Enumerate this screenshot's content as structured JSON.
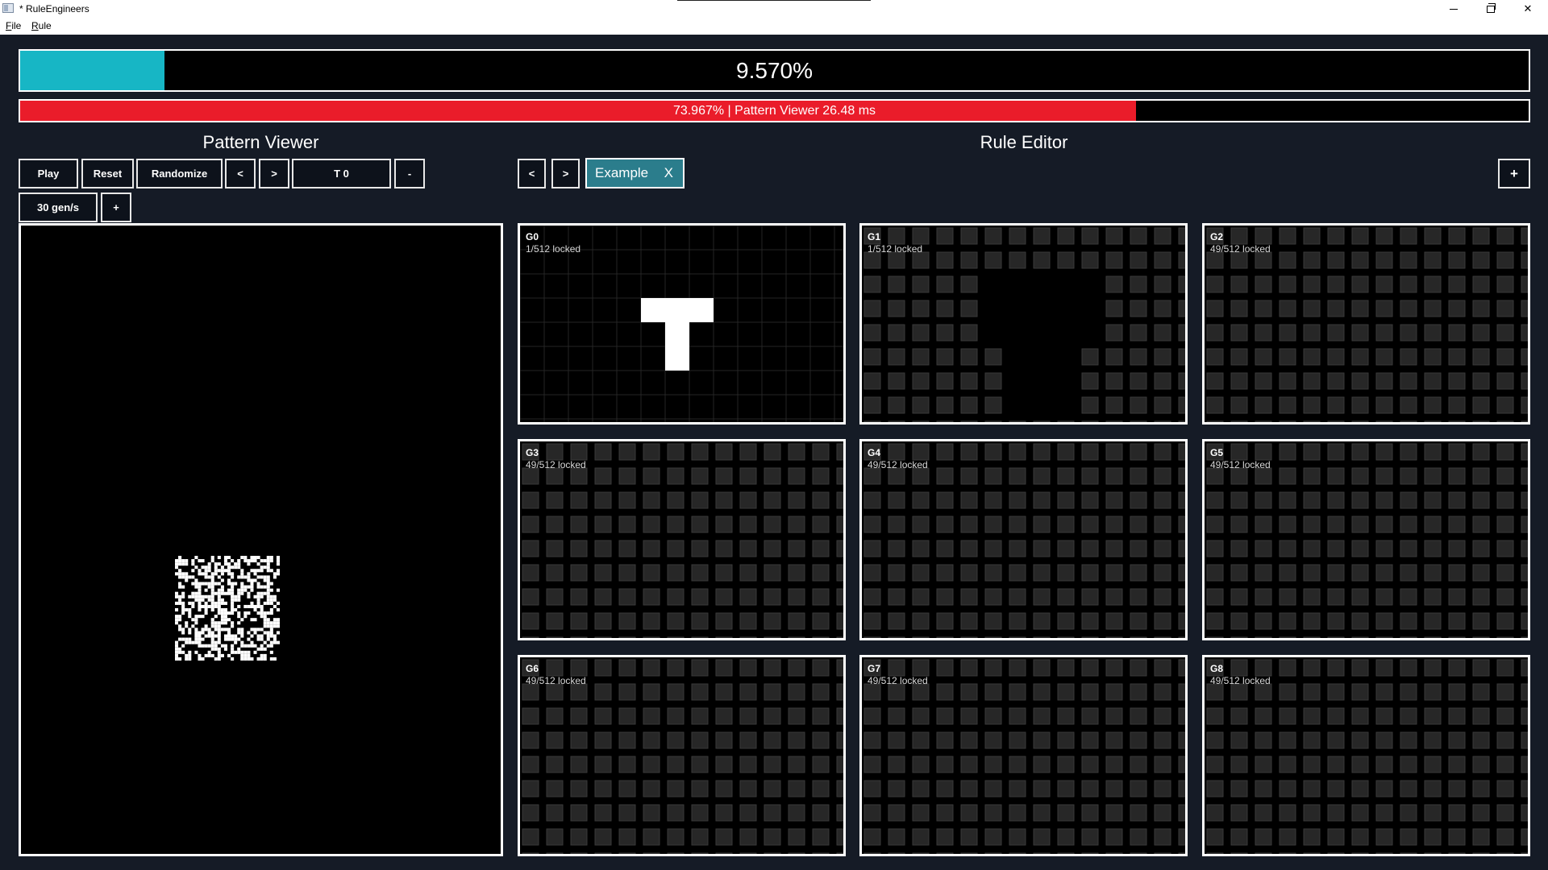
{
  "window": {
    "title": "* RuleEngineers",
    "minimize_icon": "minimize-icon",
    "maximize_icon": "restore-icon",
    "close_icon": "close-icon",
    "close_glyph": "✕"
  },
  "menu": {
    "file_prefix": "F",
    "file_rest": "ile",
    "rule_prefix": "R",
    "rule_rest": "ule"
  },
  "progress": {
    "main_percent": 0.0957,
    "main_label": "9.570%",
    "main_color": "#17b6c5",
    "perf_percent": 0.73967,
    "perf_label": "73.967% | Pattern Viewer 26.48 ms",
    "perf_color": "#ea1c2a"
  },
  "pattern_viewer": {
    "title": "Pattern Viewer",
    "play": "Play",
    "reset": "Reset",
    "randomize": "Randomize",
    "prev": "<",
    "next": ">",
    "time": "T 0",
    "minus": "-",
    "speed": "30 gen/s",
    "plus": "+"
  },
  "rule_editor": {
    "title": "Rule Editor",
    "prev": "<",
    "next": ">",
    "tab_label": "Example",
    "tab_close": "X",
    "add": "+",
    "generations": [
      {
        "name": "G0",
        "locked": "1/512 locked"
      },
      {
        "name": "G1",
        "locked": "1/512 locked"
      },
      {
        "name": "G2",
        "locked": "49/512 locked"
      },
      {
        "name": "G3",
        "locked": "49/512 locked"
      },
      {
        "name": "G4",
        "locked": "49/512 locked"
      },
      {
        "name": "G5",
        "locked": "49/512 locked"
      },
      {
        "name": "G6",
        "locked": "49/512 locked"
      },
      {
        "name": "G7",
        "locked": "49/512 locked"
      },
      {
        "name": "G8",
        "locked": "49/512 locked"
      }
    ]
  }
}
